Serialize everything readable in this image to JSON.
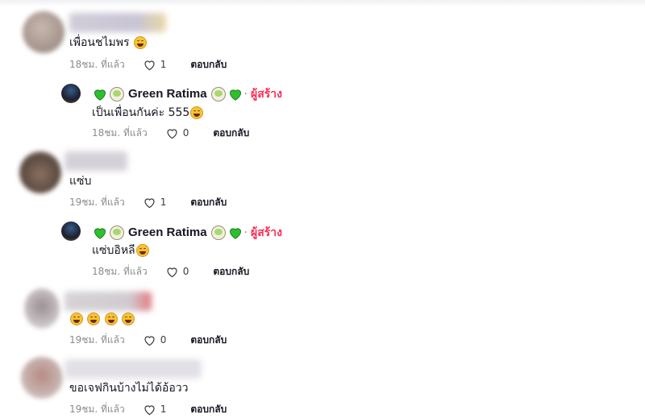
{
  "creator": {
    "name": "Green Ratima",
    "tag": "ผู้สร้าง",
    "separator": "·",
    "badge_icons": [
      "green-heart-icon",
      "bowl-icon"
    ]
  },
  "icons": {
    "like": "heart-outline-icon",
    "laugh": "laughing-emoji-icon"
  },
  "colors": {
    "creator_tag": "#fe2c55",
    "meta_text": "#8a8b91",
    "green_heart": "#2ec02e"
  },
  "comments": [
    {
      "text": "เพื่อนชไมพร",
      "emoji_count": 1,
      "time": "18ชม. ที่แล้ว",
      "likes": "1",
      "reply": "ตอบกลับ"
    },
    {
      "text": "เป็นเพื่อนกันค่ะ 555",
      "emoji_count": 1,
      "time": "18ชม. ที่แล้ว",
      "likes": "0",
      "reply": "ตอบกลับ",
      "is_creator_reply": true
    },
    {
      "text": "แซ่บ",
      "emoji_count": 0,
      "time": "19ชม. ที่แล้ว",
      "likes": "1",
      "reply": "ตอบกลับ"
    },
    {
      "text": "แซ่บอิหลี",
      "emoji_count": 1,
      "time": "18ชม. ที่แล้ว",
      "likes": "0",
      "reply": "ตอบกลับ",
      "is_creator_reply": true
    },
    {
      "text": "",
      "emoji_count": 4,
      "time": "19ชม. ที่แล้ว",
      "likes": "0",
      "reply": "ตอบกลับ"
    },
    {
      "text": "ขอเจฟกินบ้างไม่ได้อ้อวว",
      "emoji_count": 0,
      "time": "19ชม. ที่แล้ว",
      "likes": "1",
      "reply": "ตอบกลับ"
    }
  ]
}
